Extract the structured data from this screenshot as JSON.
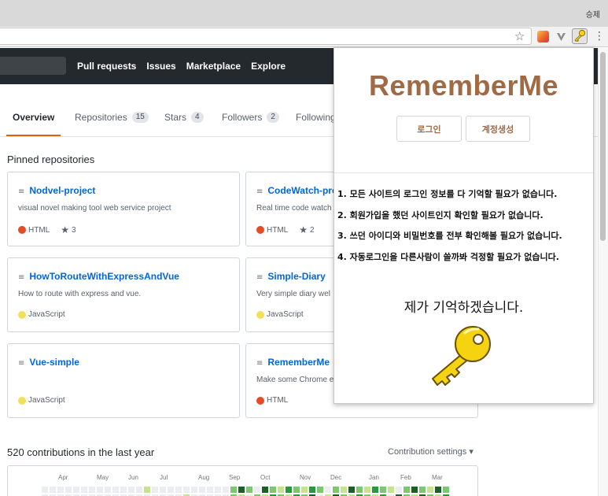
{
  "browser": {
    "profile_name": "승제",
    "icons": [
      "star-icon",
      "ext-colorful-icon",
      "ext-vee-icon",
      "ext-key-icon",
      "menu-dots-icon"
    ],
    "menu_glyph": "⋮",
    "star_glyph": "☆"
  },
  "github": {
    "nav": [
      "Pull requests",
      "Issues",
      "Marketplace",
      "Explore"
    ],
    "tabs": [
      {
        "label": "Overview",
        "count": ""
      },
      {
        "label": "Repositories",
        "count": "15"
      },
      {
        "label": "Stars",
        "count": "4"
      },
      {
        "label": "Followers",
        "count": "2"
      },
      {
        "label": "Following",
        "count": ""
      }
    ],
    "pinned_title": "Pinned repositories",
    "repos": [
      {
        "name": "Nodvel-project",
        "desc": "visual novel making tool web service project",
        "lang": "HTML",
        "lang_color": "#e34c26",
        "stars": "3"
      },
      {
        "name": "CodeWatch-pro",
        "desc": "Real time code watch",
        "lang": "HTML",
        "lang_color": "#e34c26",
        "stars": "2"
      },
      {
        "name": "HowToRouteWithExpressAndVue",
        "desc": "How to route with express and vue.",
        "lang": "JavaScript",
        "lang_color": "#f1e05a",
        "stars": ""
      },
      {
        "name": "Simple-Diary",
        "desc": "Very simple diary wel",
        "lang": "JavaScript",
        "lang_color": "#f1e05a",
        "stars": ""
      },
      {
        "name": "Vue-simple",
        "desc": "",
        "lang": "JavaScript",
        "lang_color": "#f1e05a",
        "stars": ""
      },
      {
        "name": "RememberMe",
        "desc": "Make some Chrome e",
        "lang": "HTML",
        "lang_color": "#e34c26",
        "stars": ""
      }
    ],
    "contributions_title": "520 contributions in the last year",
    "contribution_settings": "Contribution settings ▾",
    "months": [
      "Apr",
      "May",
      "Jun",
      "Jul",
      "Aug",
      "Sep",
      "Oct",
      "Nov",
      "Dec",
      "Jan",
      "Feb",
      "Mar"
    ]
  },
  "popup": {
    "brand": "RememberMe",
    "login_label": "로그인",
    "signup_label": "계정생성",
    "features": [
      "1. 모든 사이트의 로그인 정보를 다 기억할 필요가 없습니다.",
      "2. 회원가입을 했던 사이트인지 확인할 필요가 없습니다.",
      "3. 쓰던 아이디와 비밀번호를 전부 확인해볼 필요가 없습니다.",
      "4. 자동로그인을 다른사람이 쓸까봐 걱정할 필요가 없습니다."
    ],
    "tagline": "제가 기억하겠습니다.",
    "brand_color": "#a06a45",
    "key_color": "#f5d311"
  }
}
